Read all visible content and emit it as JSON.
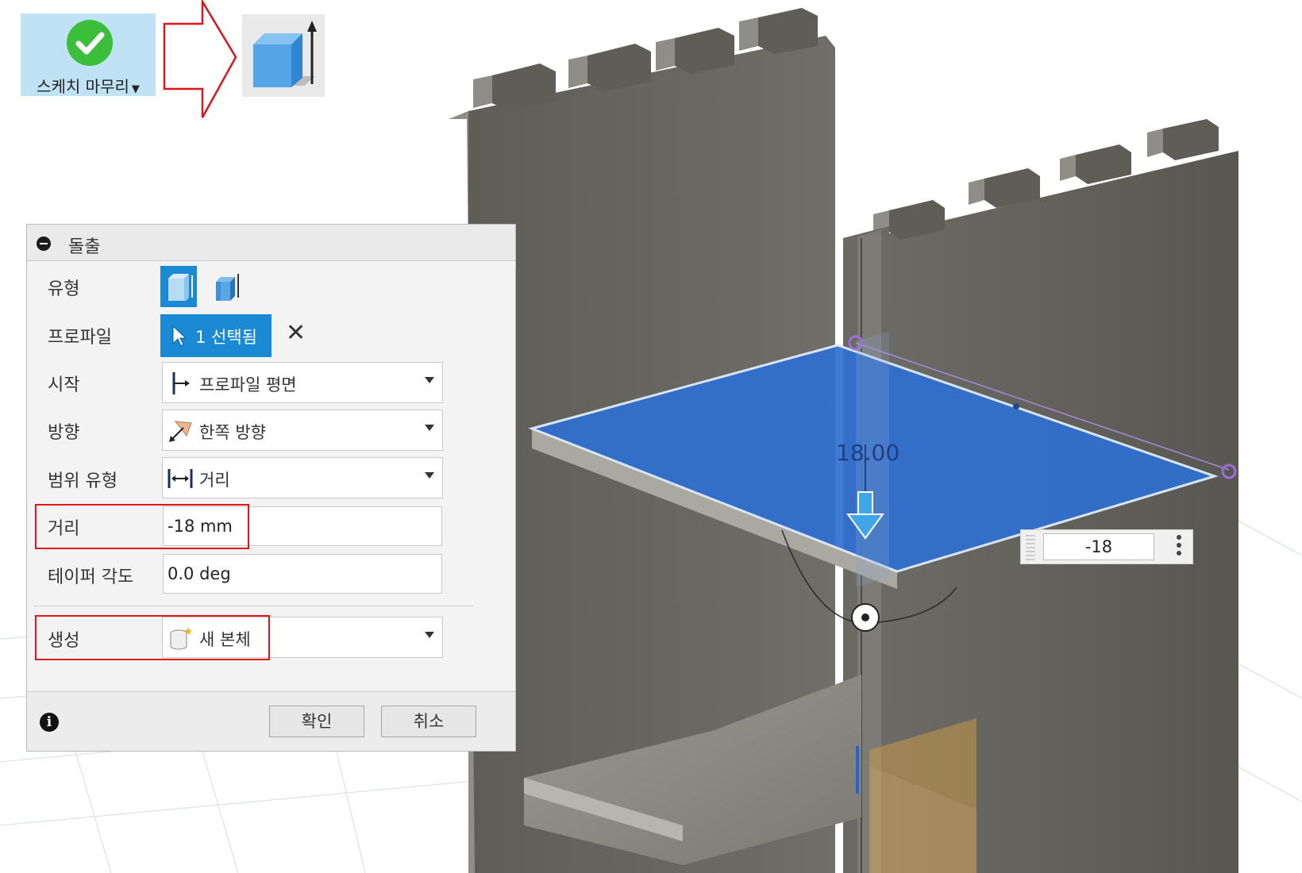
{
  "toolbar": {
    "sketch_finish_label": "스케치 마무리",
    "sketch_finish_icon": "check-circle-icon",
    "extrude_icon": "extrude-icon"
  },
  "dialog": {
    "title": "돌출",
    "rows": {
      "type": {
        "label": "유형"
      },
      "profile": {
        "label": "프로파일",
        "value": "1 선택됨"
      },
      "start": {
        "label": "시작",
        "value": "프로파일 평면"
      },
      "direction": {
        "label": "방향",
        "value": "한쪽 방향"
      },
      "extent_type": {
        "label": "범위 유형",
        "value": "거리"
      },
      "distance": {
        "label": "거리",
        "value": "-18 mm"
      },
      "taper_angle": {
        "label": "테이퍼 각도",
        "value": "0.0 deg"
      },
      "operation": {
        "label": "생성",
        "value": "새 본체"
      }
    },
    "ok_label": "확인",
    "cancel_label": "취소"
  },
  "viewport": {
    "dimension_label": "18.00",
    "dimension_input_value": "-18"
  },
  "colors": {
    "accent": "#1a8ad4",
    "highlight": "#e0141a",
    "profile_fill": "#2f6fd0",
    "model_dark": "#5a5a56"
  }
}
